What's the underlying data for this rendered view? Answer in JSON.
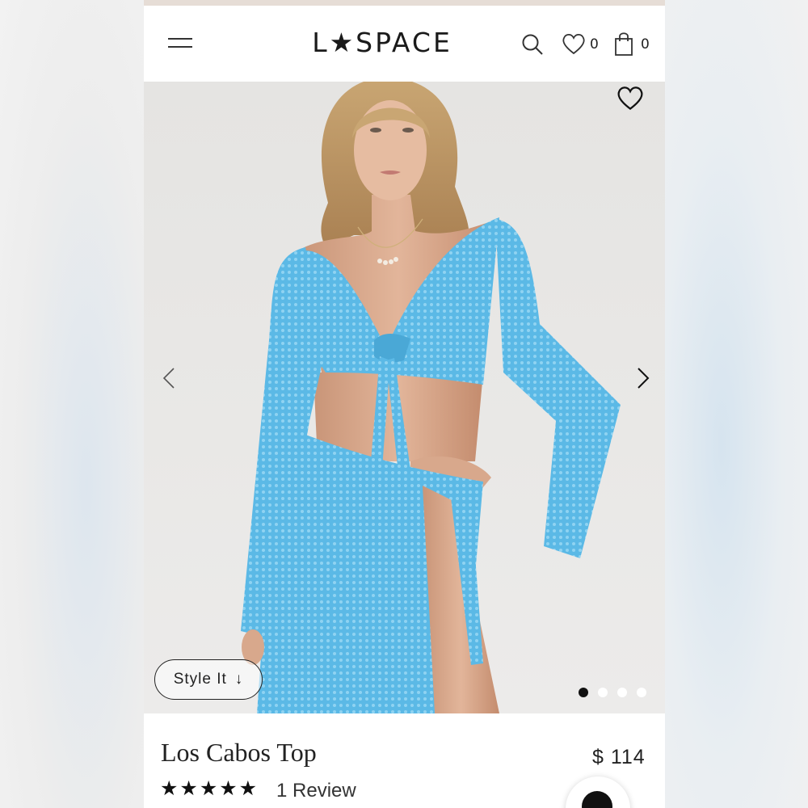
{
  "header": {
    "logo": "L★SPACE",
    "wishlist_count": "0",
    "cart_count": "0"
  },
  "icons": {
    "menu": "hamburger-menu-icon",
    "search": "search-icon",
    "wishlist": "heart-icon",
    "cart": "shopping-bag-icon",
    "prev": "chevron-left-icon",
    "next": "chevron-right-icon",
    "favorite": "heart-outline-icon",
    "chat": "chat-icon"
  },
  "gallery": {
    "style_it_label": "Style It",
    "style_it_arrow": "↓",
    "image_count": 4,
    "active_index": 0
  },
  "product": {
    "name": "Los Cabos Top",
    "price": "$ 114",
    "rating_stars": "★★★★★",
    "rating": 5,
    "reviews_label": "1 Review"
  },
  "colors": {
    "garment": "#5bb9e6",
    "text": "#222222",
    "page_bg": "#ffffff"
  }
}
